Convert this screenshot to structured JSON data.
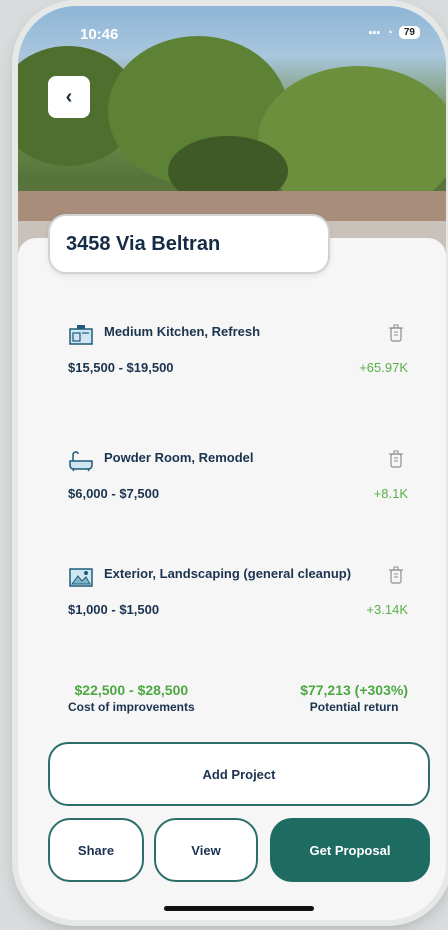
{
  "status_bar": {
    "time": "10:46",
    "battery": "79"
  },
  "property": {
    "address": "3458 Via Beltran"
  },
  "projects": [
    {
      "icon": "kitchen-icon",
      "name": "Medium Kitchen, Refresh",
      "cost": "$15,500 - $19,500",
      "gain": "+65.97K"
    },
    {
      "icon": "bathtub-icon",
      "name": "Powder Room, Remodel",
      "cost": "$6,000 - $7,500",
      "gain": "+8.1K"
    },
    {
      "icon": "landscape-icon",
      "name": "Exterior, Landscaping (general cleanup)",
      "cost": "$1,000 - $1,500",
      "gain": "+3.14K"
    }
  ],
  "summary": {
    "cost_value": "$22,500 - $28,500",
    "cost_label": "Cost of improvements",
    "return_value": "$77,213 (+303%)",
    "return_label": "Potential return"
  },
  "actions": {
    "add_project": "Add Project",
    "share": "Share",
    "view": "View",
    "get_proposal": "Get Proposal"
  },
  "colors": {
    "accent": "#1e6b62",
    "positive": "#4da844",
    "text_dark": "#1c3350"
  }
}
